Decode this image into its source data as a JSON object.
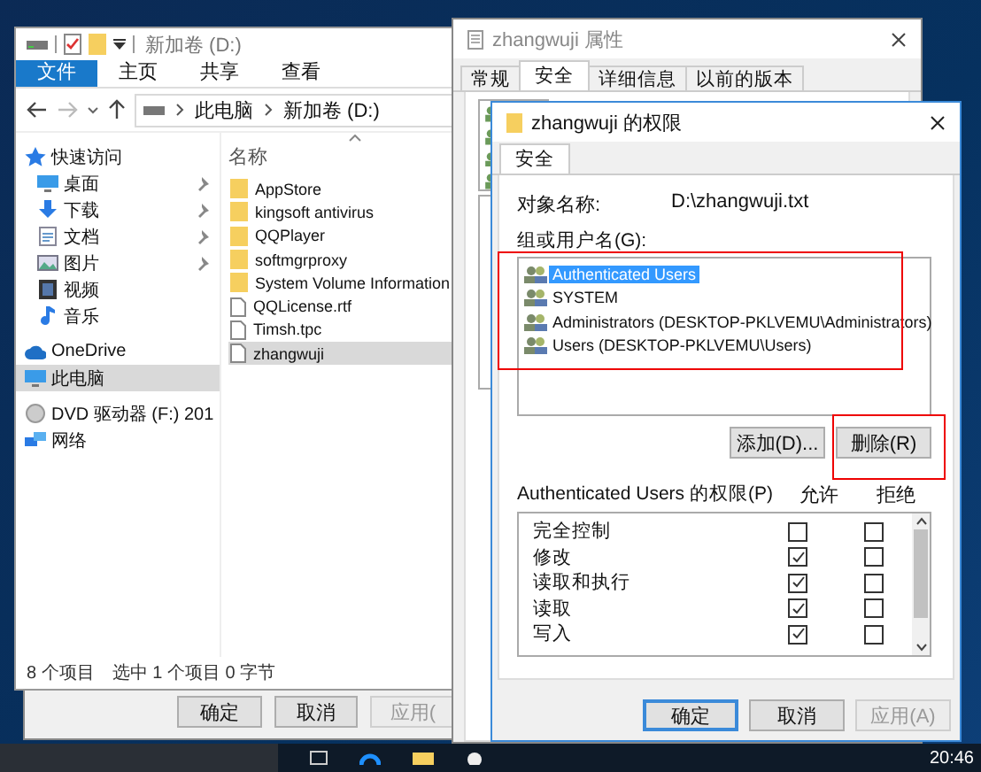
{
  "background_window": {
    "buttons": [
      {
        "label": "确定",
        "disabled": false
      },
      {
        "label": "取消",
        "disabled": false
      },
      {
        "label": "应用(",
        "disabled": true
      }
    ]
  },
  "explorer": {
    "title": "新加卷 (D:)",
    "ribbon_tabs": [
      {
        "label": "文件",
        "selected": true
      },
      {
        "label": "主页",
        "selected": false
      },
      {
        "label": "共享",
        "selected": false
      },
      {
        "label": "查看",
        "selected": false
      }
    ],
    "address": [
      "此电脑",
      "新加卷 (D:)"
    ],
    "sidebar": [
      {
        "label": "快速访问",
        "kind": "group",
        "pinned": false,
        "selected": false
      },
      {
        "label": "桌面",
        "kind": "item",
        "pinned": true,
        "selected": false
      },
      {
        "label": "下载",
        "kind": "item",
        "pinned": true,
        "selected": false
      },
      {
        "label": "文档",
        "kind": "item",
        "pinned": true,
        "selected": false
      },
      {
        "label": "图片",
        "kind": "item",
        "pinned": true,
        "selected": false
      },
      {
        "label": "视频",
        "kind": "item",
        "pinned": false,
        "selected": false
      },
      {
        "label": "音乐",
        "kind": "item",
        "pinned": false,
        "selected": false
      },
      {
        "label": "OneDrive",
        "kind": "group",
        "pinned": false,
        "selected": false
      },
      {
        "label": "此电脑",
        "kind": "group",
        "pinned": false,
        "selected": true
      },
      {
        "label": "DVD 驱动器 (F:) 201",
        "kind": "group",
        "pinned": false,
        "selected": false
      },
      {
        "label": "网络",
        "kind": "group",
        "pinned": false,
        "selected": false
      }
    ],
    "column_header": "名称",
    "files": [
      {
        "name": "AppStore",
        "kind": "folder",
        "selected": false
      },
      {
        "name": "kingsoft antivirus",
        "kind": "folder",
        "selected": false
      },
      {
        "name": "QQPlayer",
        "kind": "folder",
        "selected": false
      },
      {
        "name": "softmgrproxy",
        "kind": "folder",
        "selected": false
      },
      {
        "name": "System Volume Information",
        "kind": "folder",
        "selected": false
      },
      {
        "name": "QQLicense.rtf",
        "kind": "file",
        "selected": false
      },
      {
        "name": "Timsh.tpc",
        "kind": "file",
        "selected": false
      },
      {
        "name": "zhangwuji",
        "kind": "file",
        "selected": true
      }
    ],
    "status_bar": [
      "8 个项目",
      "选中 1 个项目  0 字节"
    ]
  },
  "properties": {
    "title": "zhangwuji 属性",
    "tabs": [
      {
        "label": "常规",
        "selected": false
      },
      {
        "label": "安全",
        "selected": true
      },
      {
        "label": "详细信息",
        "selected": false
      },
      {
        "label": "以前的版本",
        "selected": false
      }
    ]
  },
  "permissions_dialog": {
    "title": "zhangwuji 的权限",
    "tabs": [
      {
        "label": "安全",
        "selected": true
      }
    ],
    "object_label": "对象名称:",
    "object_value": "D:\\zhangwuji.txt",
    "groups_label": "组或用户名(G):",
    "groups": [
      {
        "name": "Authenticated Users",
        "selected": true
      },
      {
        "name": "SYSTEM",
        "selected": false
      },
      {
        "name": "Administrators (DESKTOP-PKLVEMU\\Administrators)",
        "selected": false
      },
      {
        "name": "Users (DESKTOP-PKLVEMU\\Users)",
        "selected": false
      }
    ],
    "group_buttons": [
      "添加(D)...",
      "删除(R)"
    ],
    "permissions_label": "Authenticated Users 的权限(P)",
    "allow_header": "允许",
    "deny_header": "拒绝",
    "permissions": [
      {
        "name": "完全控制",
        "allow": false,
        "deny": false
      },
      {
        "name": "修改",
        "allow": true,
        "deny": false
      },
      {
        "name": "读取和执行",
        "allow": true,
        "deny": false
      },
      {
        "name": "读取",
        "allow": true,
        "deny": false
      },
      {
        "name": "写入",
        "allow": true,
        "deny": false
      }
    ],
    "buttons": [
      {
        "label": "确定",
        "default": true,
        "disabled": false
      },
      {
        "label": "取消",
        "default": false,
        "disabled": false
      },
      {
        "label": "应用(A)",
        "default": false,
        "disabled": true
      }
    ]
  },
  "taskbar": {
    "clock": "20:46"
  }
}
